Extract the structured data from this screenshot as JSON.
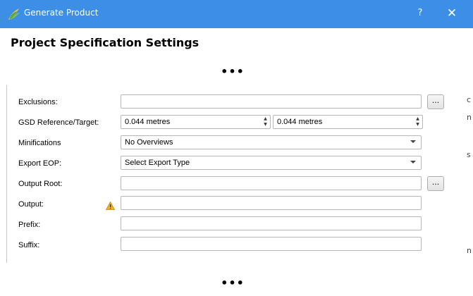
{
  "window": {
    "title": "Generate Product",
    "help_label": "?",
    "close_label": "✕"
  },
  "page": {
    "heading": "Project Specification Settings",
    "ellipsis_top": "•••",
    "ellipsis_bottom": "•••"
  },
  "form": {
    "exclusions": {
      "label": "Exclusions:",
      "value": "",
      "browse_label": "..."
    },
    "gsd": {
      "label": "GSD Reference/Target:",
      "reference_value": "0.044 metres",
      "target_value": "0.044 metres"
    },
    "minifications": {
      "label": "Minifications",
      "selected": "No Overviews"
    },
    "export_eop": {
      "label": "Export EOP:",
      "selected": "Select Export Type"
    },
    "output_root": {
      "label": "Output Root:",
      "value": "",
      "browse_label": "..."
    },
    "output": {
      "label": "Output:",
      "value": ""
    },
    "prefix": {
      "label": "Prefix:",
      "value": ""
    },
    "suffix": {
      "label": "Suffix:",
      "value": ""
    }
  },
  "background_fragments": [
    "c",
    "n",
    "s",
    "n"
  ],
  "colors": {
    "titlebar": "#3c8ee6",
    "warning": "#f2b01e",
    "logo_green": "#5aa83c"
  },
  "icons": {
    "app": "app-leaf-icon",
    "warning": "warning-icon",
    "spin": "spin-arrows-icon",
    "dropdown": "chevron-down-icon"
  }
}
